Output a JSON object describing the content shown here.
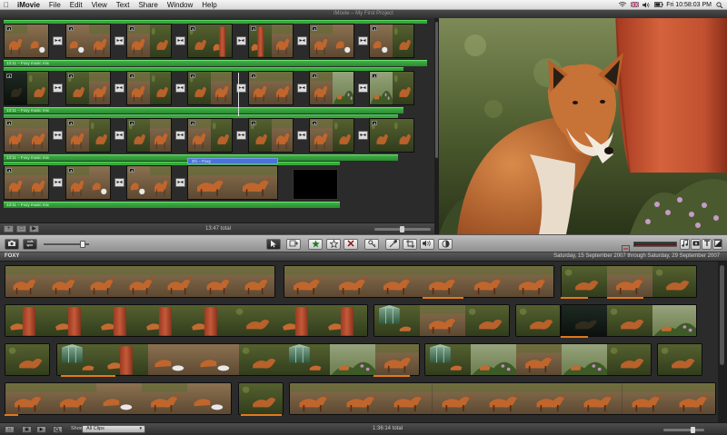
{
  "menubar": {
    "app": "iMovie",
    "items": [
      "File",
      "Edit",
      "View",
      "Text",
      "Share",
      "Window",
      "Help"
    ],
    "clock": "Fri 10:58:03 PM"
  },
  "window": {
    "title": "iMovie – My First Project"
  },
  "project": {
    "music_label": "13:11 – Foxy music mix",
    "title_clip_label": "3½ – Foxy",
    "total": "13:47 total"
  },
  "events": {
    "event_name": "FOXY",
    "date_range": "Saturday, 15 September 2007 through Saturday, 29 September 2007"
  },
  "statusbar": {
    "show_label": "Show:",
    "filter_value": "All Clips",
    "total": "1:36:14 total"
  },
  "colors": {
    "music_track": "#35a83a",
    "title_bar": "#4b72d8",
    "favorite_marker": "#e2781b",
    "audio_meter": "#b7131a"
  }
}
